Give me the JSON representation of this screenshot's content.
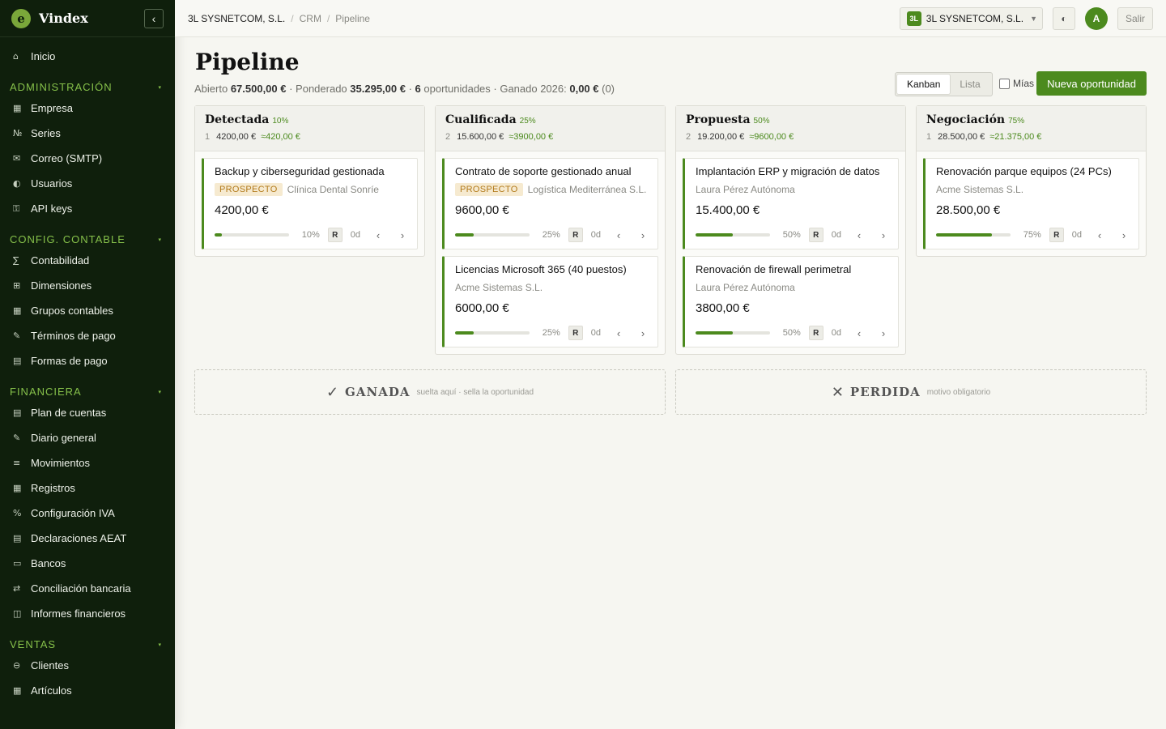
{
  "app": {
    "brand": "Vindex",
    "logo_letter": "e",
    "collapse_icon": "‹"
  },
  "sidebar": {
    "inicio": {
      "icon": "⌂",
      "label": "Inicio"
    },
    "sections": [
      {
        "title": "ADMINISTRACIÓN",
        "items": [
          {
            "icon": "▦",
            "label": "Empresa"
          },
          {
            "icon": "№",
            "label": "Series"
          },
          {
            "icon": "✉",
            "label": "Correo (SMTP)"
          },
          {
            "icon": "◐",
            "label": "Usuarios"
          },
          {
            "icon": "⚿",
            "label": "API keys"
          }
        ]
      },
      {
        "title": "CONFIG. CONTABLE",
        "items": [
          {
            "icon": "∑",
            "label": "Contabilidad"
          },
          {
            "icon": "⊞",
            "label": "Dimensiones"
          },
          {
            "icon": "▦",
            "label": "Grupos contables"
          },
          {
            "icon": "✎",
            "label": "Términos de pago"
          },
          {
            "icon": "▤",
            "label": "Formas de pago"
          }
        ]
      },
      {
        "title": "FINANCIERA",
        "items": [
          {
            "icon": "▤",
            "label": "Plan de cuentas"
          },
          {
            "icon": "✎",
            "label": "Diario general"
          },
          {
            "icon": "≡",
            "label": "Movimientos"
          },
          {
            "icon": "▦",
            "label": "Registros"
          },
          {
            "icon": "%",
            "label": "Configuración IVA"
          },
          {
            "icon": "▤",
            "label": "Declaraciones AEAT"
          },
          {
            "icon": "▭",
            "label": "Bancos"
          },
          {
            "icon": "⇄",
            "label": "Conciliación bancaria"
          },
          {
            "icon": "◫",
            "label": "Informes financieros"
          }
        ]
      },
      {
        "title": "VENTAS",
        "items": [
          {
            "icon": "⊖",
            "label": "Clientes"
          },
          {
            "icon": "▦",
            "label": "Artículos"
          }
        ]
      }
    ]
  },
  "topbar": {
    "breadcrumb": [
      "3L SYSNETCOM, S.L.",
      "CRM",
      "Pipeline"
    ],
    "company_badge": "3L",
    "company_name": "3L SYSNETCOM, S.L.",
    "company_caret": "▼",
    "theme_icon": "◐",
    "avatar_letter": "A",
    "logout_label": "Salir"
  },
  "header": {
    "title": "Pipeline",
    "summary": {
      "open_label": "Abierto ",
      "open_value": "67.500,00 €",
      "weighted_label": " · Ponderado ",
      "weighted_value": "35.295,00 €",
      "sep": " · ",
      "count_value": "6",
      "count_label": " oportunidades · Ganado 2026: ",
      "won_value": "0,00 €",
      "won_count": " (0)"
    },
    "view_kanban": "Kanban",
    "view_list": "Lista",
    "mias_label": "Mías",
    "new_button": "Nueva oportunidad"
  },
  "columns": [
    {
      "title": "Detectada",
      "pct": "10%",
      "count": "1",
      "total": "4200,00 €",
      "weighted": "≈420,00 €",
      "cards": [
        {
          "title": "Backup y ciberseguridad gestionada",
          "tag": "PROSPECTO",
          "client": "Clínica Dental Sonríe",
          "amount": "4200,00 €",
          "progress": 0.1,
          "pct": "10%",
          "r": "R",
          "days": "0d"
        }
      ]
    },
    {
      "title": "Cualificada",
      "pct": "25%",
      "count": "2",
      "total": "15.600,00 €",
      "weighted": "≈3900,00 €",
      "cards": [
        {
          "title": "Contrato de soporte gestionado anual",
          "tag": "PROSPECTO",
          "client": "Logística Mediterránea S.L.",
          "amount": "9600,00 €",
          "progress": 0.25,
          "pct": "25%",
          "r": "R",
          "days": "0d"
        },
        {
          "title": "Licencias Microsoft 365 (40 puestos)",
          "tag": "",
          "client": "Acme Sistemas S.L.",
          "amount": "6000,00 €",
          "progress": 0.25,
          "pct": "25%",
          "r": "R",
          "days": "0d"
        }
      ]
    },
    {
      "title": "Propuesta",
      "pct": "50%",
      "count": "2",
      "total": "19.200,00 €",
      "weighted": "≈9600,00 €",
      "cards": [
        {
          "title": "Implantación ERP y migración de datos",
          "tag": "",
          "client": "Laura Pérez Autónoma",
          "amount": "15.400,00 €",
          "progress": 0.5,
          "pct": "50%",
          "r": "R",
          "days": "0d"
        },
        {
          "title": "Renovación de firewall perimetral",
          "tag": "",
          "client": "Laura Pérez Autónoma",
          "amount": "3800,00 €",
          "progress": 0.5,
          "pct": "50%",
          "r": "R",
          "days": "0d"
        }
      ]
    },
    {
      "title": "Negociación",
      "pct": "75%",
      "count": "1",
      "total": "28.500,00 €",
      "weighted": "≈21.375,00 €",
      "cards": [
        {
          "title": "Renovación parque equipos (24 PCs)",
          "tag": "",
          "client": "Acme Sistemas S.L.",
          "amount": "28.500,00 €",
          "progress": 0.75,
          "pct": "75%",
          "r": "R",
          "days": "0d"
        }
      ]
    }
  ],
  "arrows": {
    "left": "‹",
    "right": "›"
  },
  "dropzones": {
    "won": {
      "icon": "✓",
      "title": "GANADA",
      "hint": "suelta aquí · sella la oportunidad"
    },
    "lost": {
      "icon": "✕",
      "title": "PERDIDA",
      "hint": "motivo obligatorio"
    }
  },
  "colors": {
    "accent": "#4c8a1e",
    "sidebar_bg": "#0f1f0c",
    "section_title": "#86c04a",
    "tag_bg": "#f6ead0",
    "tag_text": "#b27a1a"
  }
}
